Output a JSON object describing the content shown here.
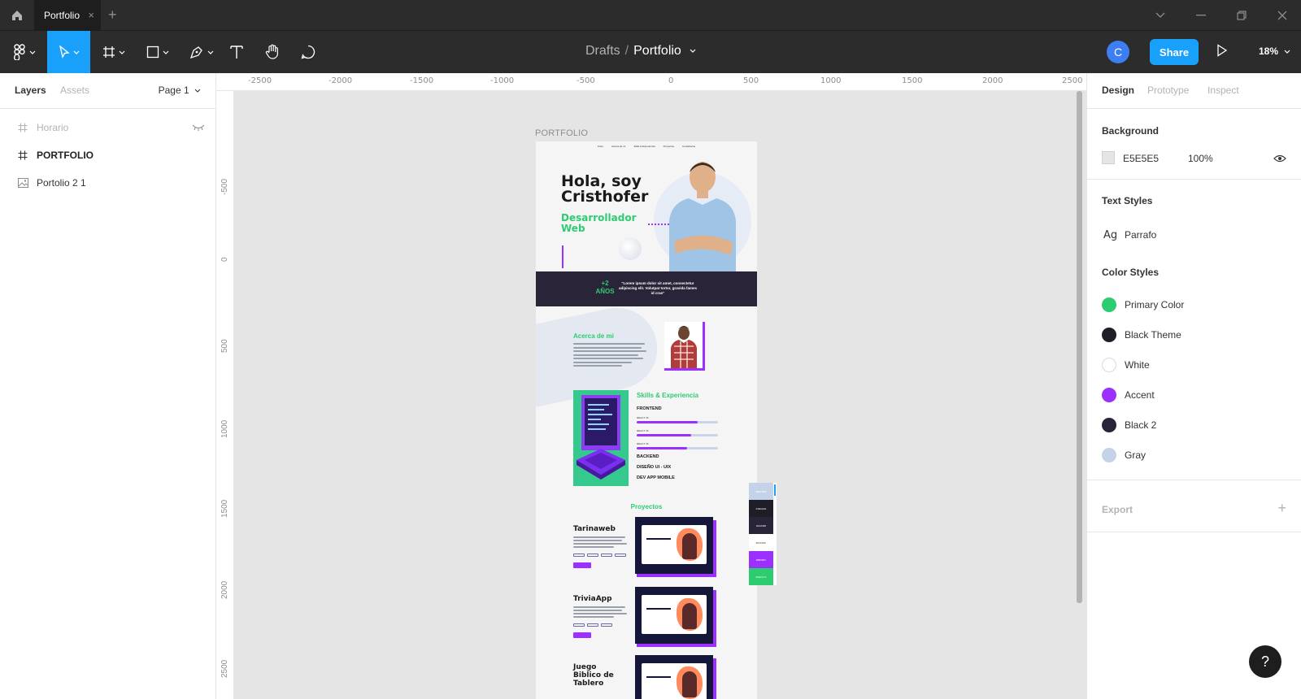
{
  "titlebar": {
    "tab_title": "Portfolio",
    "tab_close": "×",
    "tab_add": "+"
  },
  "toolbar": {
    "breadcrumb_project": "Drafts",
    "breadcrumb_sep": "/",
    "breadcrumb_file": "Portfolio",
    "avatar_initial": "C",
    "share_label": "Share",
    "zoom": "18%",
    "tools": [
      "figma-menu-icon",
      "move-tool-icon",
      "frame-tool-icon",
      "rectangle-tool-icon",
      "pen-tool-icon",
      "text-tool-icon",
      "hand-tool-icon",
      "comment-tool-icon"
    ]
  },
  "left_panel": {
    "tab_layers": "Layers",
    "tab_assets": "Assets",
    "page_selector": "Page 1",
    "layers": [
      {
        "name": "Horario",
        "type": "frame",
        "hidden": true
      },
      {
        "name": "PORTFOLIO",
        "type": "frame",
        "hidden": false
      },
      {
        "name": "Portolio 2 1",
        "type": "image",
        "hidden": false
      }
    ]
  },
  "canvas": {
    "ruler_top": [
      "-2500",
      "-2000",
      "-1500",
      "-1000",
      "-500",
      "0",
      "500",
      "1000",
      "1500",
      "2000",
      "2500"
    ],
    "ruler_left": [
      "-500",
      "0",
      "500",
      "1000",
      "1500",
      "2000",
      "2500"
    ],
    "frame_label": "PORTFOLIO",
    "frame": {
      "nav": [
        "Inicio",
        "Acerca de mi",
        "Skills & Experiencia",
        "Proyectos",
        "Contáctame"
      ],
      "hero_title": "Hola, soy Cristhofer",
      "hero_subtitle": "Desarrollador Web",
      "band_number": "+2 AÑOS",
      "band_quote": "\"Lorem ipsum dolor sit amet, consectetur adipiscing elit. Volutpat tortor, gravida fames id cras\"",
      "about_title": "Acerca de mi",
      "skills_title": "Skills & Experiencia",
      "skills_frontend": "FRONTEND",
      "skill_items": [
        {
          "label": "REACT JS",
          "value": 0.75
        },
        {
          "label": "REACT JS",
          "value": 0.67
        },
        {
          "label": "REACT JS",
          "value": 0.62
        }
      ],
      "skills_backend": "BACKEND",
      "skills_design": "DISEÑO UI - UIX",
      "skills_mobile": "DEV APP MOBILE",
      "projects_title": "Proyectos",
      "projects": [
        {
          "name": "Tarinaweb"
        },
        {
          "name": "TriviaApp"
        },
        {
          "name": "Juego Biblico de Tablero"
        }
      ]
    },
    "swatches": [
      {
        "label": "#B8C6DB",
        "color": "#c5d3ea"
      },
      {
        "label": "#1E1E1E",
        "color": "#1e1e26"
      },
      {
        "label": "#2A2438",
        "color": "#2a2438"
      },
      {
        "label": "#FFFFFF",
        "color": "#ffffff"
      },
      {
        "label": "#9B30FF",
        "color": "#9b30ff"
      },
      {
        "label": "#2ECC71",
        "color": "#2ecc71"
      }
    ]
  },
  "right_panel": {
    "tab_design": "Design",
    "tab_prototype": "Prototype",
    "tab_inspect": "Inspect",
    "background_title": "Background",
    "background_hex": "E5E5E5",
    "background_opacity": "100%",
    "text_styles_title": "Text Styles",
    "text_style_icon": "Ag",
    "text_style_name": "Parrafo",
    "color_styles_title": "Color Styles",
    "color_styles": [
      {
        "name": "Primary Color",
        "color": "#2ecc71"
      },
      {
        "name": "Black Theme",
        "color": "#1e1e26"
      },
      {
        "name": "White",
        "color": "#ffffff"
      },
      {
        "name": "Accent",
        "color": "#9b30ff"
      },
      {
        "name": "Black 2",
        "color": "#2a2438"
      },
      {
        "name": "Gray",
        "color": "#c5d3ea"
      }
    ],
    "export_title": "Export",
    "export_add": "+"
  },
  "help_label": "?"
}
